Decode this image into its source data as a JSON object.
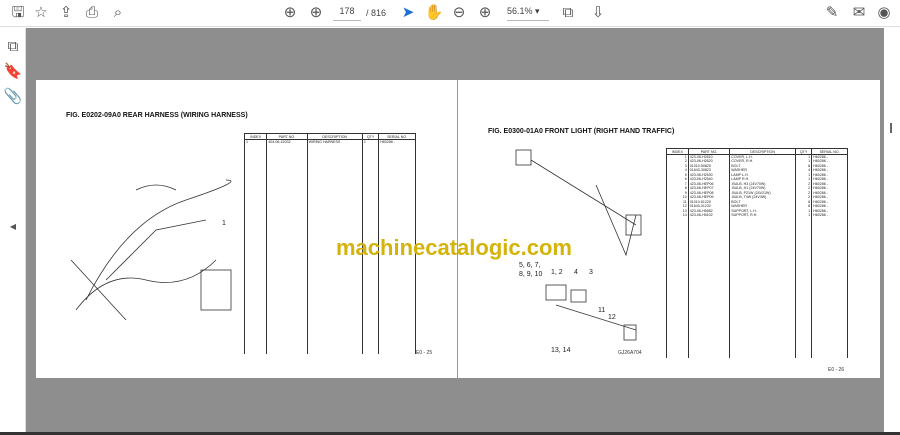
{
  "toolbar": {
    "page_current": "178",
    "page_total": "/ 816",
    "zoom": "56.1%"
  },
  "left_page": {
    "title": "FIG. E0202-09A0    REAR HARNESS (WIRING HARNESS)",
    "headers": [
      "INDEX",
      "PART NO.",
      "DESCRIPTION",
      "QTY",
      "SERIAL NO."
    ],
    "rows": [
      [
        "1",
        "404-06-42032",
        "WIRING HARNESS",
        "1",
        "H60286 -"
      ]
    ],
    "page_no": "E0 - 25",
    "callout": "1"
  },
  "right_page": {
    "title": "FIG. E0300-01A0    FRONT LIGHT (RIGHT HAND TRAFFIC)",
    "headers": [
      "INDEX",
      "PART NO.",
      "DESCRIPTION",
      "QTY",
      "SERIAL NO."
    ],
    "rows": [
      [
        "1",
        "423-06-H2610",
        "COVER, L.H.",
        "1",
        "H60286 -"
      ],
      [
        "2",
        "423-06-H2620",
        "COVER, R.H.",
        "1",
        "H60286 -"
      ],
      [
        "3",
        "01010-50820",
        "BOLT",
        "8",
        "H60286 -"
      ],
      [
        "4",
        "01643-30823",
        "WASHER",
        "4",
        "H60286 -"
      ],
      [
        "5",
        "423-06-H2530",
        "LAMP L.H.",
        "1",
        "H60286 -"
      ],
      [
        "6",
        "423-06-H2540",
        "LAMP R.H.",
        "1",
        "H60286 -"
      ],
      [
        "7",
        "423-06-HEP06",
        ".BULB, H3 (24V70W)",
        "2",
        "H60286 -"
      ],
      [
        "8",
        "423-06-HEP07",
        ".BULB, H1 (24V70W)",
        "2",
        "H60286 -"
      ],
      [
        "9",
        "423-06-HEP08",
        ".BULB, P21W (24V21W)",
        "2",
        "H60286 -"
      ],
      [
        "10",
        "423-06-HEP09",
        ".BULB, T4W (24V4W)",
        "2",
        "H60286 -"
      ],
      [
        "11",
        "01010-81220",
        "BOLT",
        "8",
        "H60286 -"
      ],
      [
        "12",
        "01643-31232",
        "WASHER",
        "8",
        "H60286 -"
      ],
      [
        "13",
        "423-06-H5682",
        "SUPPORT, L.H.",
        "1",
        "H60286 -"
      ],
      [
        "14",
        "423-06-H5102",
        "SUPPORT, R.H.",
        "1",
        "H60286 -"
      ]
    ],
    "page_no": "E0 - 26",
    "callouts": [
      "5, 6, 7,",
      "8, 9, 10",
      "1, 2",
      "4",
      "3",
      "11",
      "12",
      "13, 14"
    ],
    "drawing_code": "GJ26A704"
  },
  "watermark": "machinecatalogic.com"
}
